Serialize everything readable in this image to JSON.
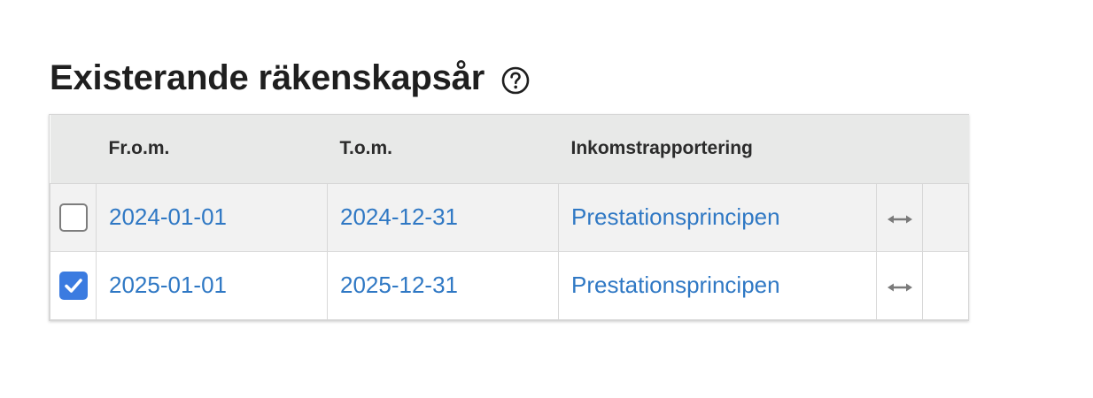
{
  "heading": {
    "title": "Existerande räkenskapsår",
    "help_icon": "question-circle-icon"
  },
  "table": {
    "columns": [
      "",
      "Fr.o.m.",
      "T.o.m.",
      "Inkomstrapportering",
      "",
      ""
    ],
    "rows": [
      {
        "checked": false,
        "from": "2024-01-01",
        "to": "2024-12-31",
        "income_reporting": "Prestationsprincipen",
        "action_icon": "horizontal-resize-arrow-icon"
      },
      {
        "checked": true,
        "from": "2025-01-01",
        "to": "2025-12-31",
        "income_reporting": "Prestationsprincipen",
        "action_icon": "horizontal-resize-arrow-icon"
      }
    ]
  },
  "colors": {
    "link": "#2f78c4",
    "checkbox_checked": "#3b7be0",
    "header_bg": "#e8e9e8"
  }
}
